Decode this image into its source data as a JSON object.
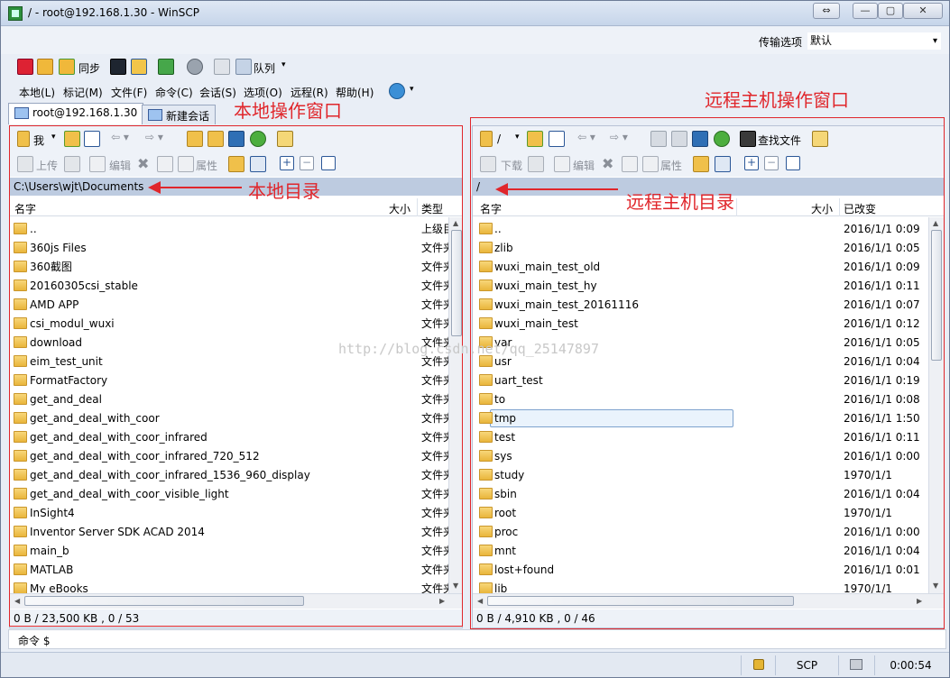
{
  "window": {
    "title": "/ - root@192.168.1.30 - WinSCP"
  },
  "transfer": {
    "label": "传输选项",
    "value": "默认"
  },
  "toolbar1": {
    "sync_label": "同步",
    "queue_label": "队列"
  },
  "menus": [
    "本地(L)",
    "标记(M)",
    "文件(F)",
    "命令(C)",
    "会话(S)",
    "选项(O)",
    "远程(R)",
    "帮助(H)"
  ],
  "tabs": [
    {
      "label": "root@192.168.1.30"
    },
    {
      "label": "新建会话"
    }
  ],
  "local": {
    "drive": "我",
    "upload": "上传",
    "edit": "编辑",
    "props": "属性",
    "path": "C:\\Users\\wjt\\Documents",
    "cols": {
      "name": "名字",
      "size": "大小",
      "type": "类型"
    },
    "files": [
      {
        "name": "..",
        "type": "上级目"
      },
      {
        "name": "360js Files",
        "type": "文件夹"
      },
      {
        "name": "360截图",
        "type": "文件夹"
      },
      {
        "name": "20160305csi_stable",
        "type": "文件夹"
      },
      {
        "name": "AMD APP",
        "type": "文件夹"
      },
      {
        "name": "csi_modul_wuxi",
        "type": "文件夹"
      },
      {
        "name": "download",
        "type": "文件夹"
      },
      {
        "name": "eim_test_unit",
        "type": "文件夹"
      },
      {
        "name": "FormatFactory",
        "type": "文件夹"
      },
      {
        "name": "get_and_deal",
        "type": "文件夹"
      },
      {
        "name": "get_and_deal_with_coor",
        "type": "文件夹"
      },
      {
        "name": "get_and_deal_with_coor_infrared",
        "type": "文件夹"
      },
      {
        "name": "get_and_deal_with_coor_infrared_720_512",
        "type": "文件夹"
      },
      {
        "name": "get_and_deal_with_coor_infrared_1536_960_display",
        "type": "文件夹"
      },
      {
        "name": "get_and_deal_with_coor_visible_light",
        "type": "文件夹"
      },
      {
        "name": "InSight4",
        "type": "文件夹"
      },
      {
        "name": "Inventor Server SDK ACAD 2014",
        "type": "文件夹"
      },
      {
        "name": "main_b",
        "type": "文件夹"
      },
      {
        "name": "MATLAB",
        "type": "文件夹"
      },
      {
        "name": "My eBooks",
        "type": "文件夹"
      }
    ],
    "status": "0 B / 23,500 KB ,  0 / 53"
  },
  "remote": {
    "drive": "/",
    "find": "查找文件",
    "download": "下载",
    "edit": "编辑",
    "props": "属性",
    "path": "/",
    "cols": {
      "name": "名字",
      "size": "大小",
      "changed": "已改变"
    },
    "files": [
      {
        "name": "..",
        "changed": "2016/1/1 0:09"
      },
      {
        "name": "zlib",
        "changed": "2016/1/1 0:05"
      },
      {
        "name": "wuxi_main_test_old",
        "changed": "2016/1/1 0:09"
      },
      {
        "name": "wuxi_main_test_hy",
        "changed": "2016/1/1 0:11"
      },
      {
        "name": "wuxi_main_test_20161116",
        "changed": "2016/1/1 0:07"
      },
      {
        "name": "wuxi_main_test",
        "changed": "2016/1/1 0:12"
      },
      {
        "name": "var",
        "changed": "2016/1/1 0:05"
      },
      {
        "name": "usr",
        "changed": "2016/1/1 0:04"
      },
      {
        "name": "uart_test",
        "changed": "2016/1/1 0:19"
      },
      {
        "name": "to",
        "changed": "2016/1/1 0:08"
      },
      {
        "name": "tmp",
        "changed": "2016/1/1 1:50"
      },
      {
        "name": "test",
        "changed": "2016/1/1 0:11"
      },
      {
        "name": "sys",
        "changed": "2016/1/1 0:00"
      },
      {
        "name": "study",
        "changed": "1970/1/1"
      },
      {
        "name": "sbin",
        "changed": "2016/1/1 0:04"
      },
      {
        "name": "root",
        "changed": "1970/1/1"
      },
      {
        "name": "proc",
        "changed": "2016/1/1 0:00"
      },
      {
        "name": "mnt",
        "changed": "2016/1/1 0:04"
      },
      {
        "name": "lost+found",
        "changed": "2016/1/1 0:01"
      },
      {
        "name": "lib",
        "changed": "1970/1/1"
      }
    ],
    "status": "0 B / 4,910 KB ,  0 / 46"
  },
  "command": {
    "label": "命令 $"
  },
  "statusbar": {
    "protocol": "SCP",
    "time": "0:00:54"
  },
  "annotations": {
    "local_window": "本地操作窗口",
    "remote_window": "远程主机操作窗口",
    "local_dir": "本地目录",
    "remote_dir": "远程主机目录",
    "watermark": "http://blog.csdn.net/qq_25147897"
  },
  "colors": {
    "annotation": "#e0262b",
    "pathbar": "#bdcbe0",
    "folder": "#e9b53b"
  }
}
